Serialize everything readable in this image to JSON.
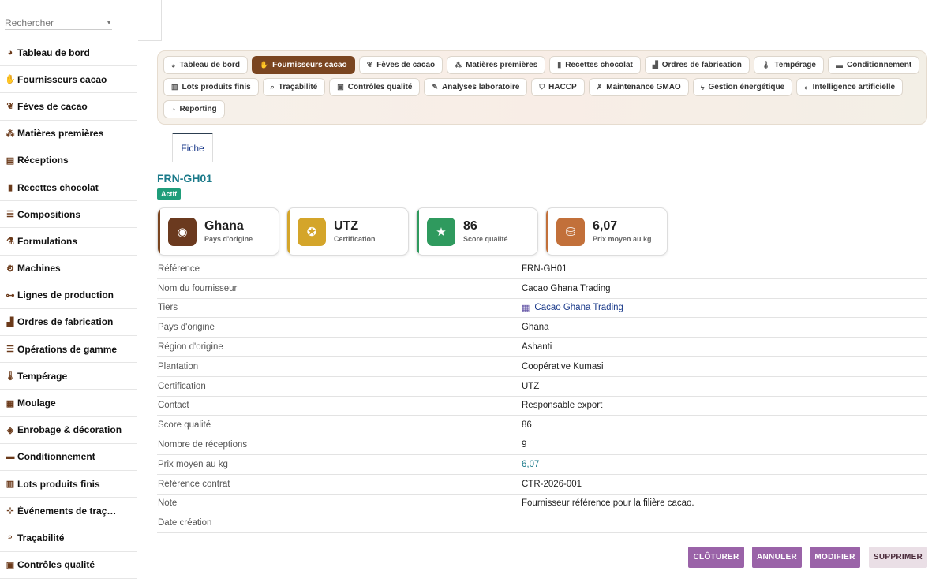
{
  "search": {
    "placeholder": "Rechercher"
  },
  "sidebar": {
    "items": [
      {
        "label": "Tableau de bord",
        "icon": "gauge-icon",
        "glyph": "◕"
      },
      {
        "label": "Fournisseurs cacao",
        "icon": "handshake-icon",
        "glyph": "✋"
      },
      {
        "label": "Fèves de cacao",
        "icon": "seedling-icon",
        "glyph": "❦"
      },
      {
        "label": "Matières premières",
        "icon": "cubes-icon",
        "glyph": "⁂"
      },
      {
        "label": "Réceptions",
        "icon": "truck-loading-icon",
        "glyph": "▤"
      },
      {
        "label": "Recettes chocolat",
        "icon": "book-icon",
        "glyph": "▮"
      },
      {
        "label": "Compositions",
        "icon": "list-icon",
        "glyph": "☰"
      },
      {
        "label": "Formulations",
        "icon": "flask-icon",
        "glyph": "⚗"
      },
      {
        "label": "Machines",
        "icon": "gears-icon",
        "glyph": "⚙"
      },
      {
        "label": "Lignes de production",
        "icon": "diagram-icon",
        "glyph": "⊶"
      },
      {
        "label": "Ordres de fabrication",
        "icon": "industry-icon",
        "glyph": "▟"
      },
      {
        "label": "Opérations de gamme",
        "icon": "list-check-icon",
        "glyph": "☰"
      },
      {
        "label": "Tempérage",
        "icon": "thermometer-icon",
        "glyph": "🌡"
      },
      {
        "label": "Moulage",
        "icon": "grid-icon",
        "glyph": "▦"
      },
      {
        "label": "Enrobage & décoration",
        "icon": "fill-drip-icon",
        "glyph": "◈"
      },
      {
        "label": "Conditionnement",
        "icon": "box-icon",
        "glyph": "▬"
      },
      {
        "label": "Lots produits finis",
        "icon": "barcode-icon",
        "glyph": "▥"
      },
      {
        "label": "Événements de traç…",
        "icon": "sitemap-icon",
        "glyph": "⊹"
      },
      {
        "label": "Traçabilité",
        "icon": "search-icon",
        "glyph": "⌕"
      },
      {
        "label": "Contrôles qualité",
        "icon": "clipboard-check-icon",
        "glyph": "▣"
      }
    ]
  },
  "nav": {
    "rows": [
      [
        {
          "label": "Tableau de bord",
          "icon": "gauge-icon",
          "glyph": "◕",
          "active": false
        },
        {
          "label": "Fournisseurs cacao",
          "icon": "handshake-icon",
          "glyph": "✋",
          "active": true
        },
        {
          "label": "Fèves de cacao",
          "icon": "seedling-icon",
          "glyph": "❦",
          "active": false
        },
        {
          "label": "Matières premières",
          "icon": "cubes-icon",
          "glyph": "⁂",
          "active": false
        },
        {
          "label": "Recettes chocolat",
          "icon": "book-icon",
          "glyph": "▮",
          "active": false
        },
        {
          "label": "Ordres de fabrication",
          "icon": "industry-icon",
          "glyph": "▟",
          "active": false
        },
        {
          "label": "Tempérage",
          "icon": "thermometer-icon",
          "glyph": "🌡",
          "active": false
        },
        {
          "label": "Conditionnement",
          "icon": "box-icon",
          "glyph": "▬",
          "active": false
        }
      ],
      [
        {
          "label": "Lots produits finis",
          "icon": "barcode-icon",
          "glyph": "▥",
          "active": false
        },
        {
          "label": "Traçabilité",
          "icon": "search-icon",
          "glyph": "⌕",
          "active": false
        },
        {
          "label": "Contrôles qualité",
          "icon": "clipboard-check-icon",
          "glyph": "▣",
          "active": false
        },
        {
          "label": "Analyses laboratoire",
          "icon": "pen-icon",
          "glyph": "✎",
          "active": false
        },
        {
          "label": "HACCP",
          "icon": "shield-icon",
          "glyph": "⛉",
          "active": false
        },
        {
          "label": "Maintenance GMAO",
          "icon": "tools-icon",
          "glyph": "✗",
          "active": false
        },
        {
          "label": "Gestion énergétique",
          "icon": "bolt-icon",
          "glyph": "ϟ",
          "active": false
        },
        {
          "label": "Intelligence artificielle",
          "icon": "brain-icon",
          "glyph": "◐",
          "active": false
        }
      ],
      [
        {
          "label": "Reporting",
          "icon": "pie-chart-icon",
          "glyph": "◔",
          "active": false
        }
      ]
    ]
  },
  "tabs": {
    "fiche": "Fiche"
  },
  "record": {
    "title": "FRN-GH01",
    "status": "Actif"
  },
  "cards": [
    {
      "value": "Ghana",
      "label": "Pays d'origine",
      "icon": "globe-icon",
      "glyph": "◉",
      "color": "#6b3a1f",
      "bar": "#7a4520"
    },
    {
      "value": "UTZ",
      "label": "Certification",
      "icon": "award-icon",
      "glyph": "✪",
      "color": "#d4a52a",
      "bar": "#d4a52a"
    },
    {
      "value": "86",
      "label": "Score qualité",
      "icon": "star-icon",
      "glyph": "★",
      "color": "#2f9a5e",
      "bar": "#2f9a5e"
    },
    {
      "value": "6,07",
      "label": "Prix moyen au kg",
      "icon": "coins-icon",
      "glyph": "⛁",
      "color": "#c2703a",
      "bar": "#c2703a"
    }
  ],
  "details": [
    {
      "key": "Référence",
      "value": "FRN-GH01",
      "style": ""
    },
    {
      "key": "Nom du fournisseur",
      "value": "Cacao Ghana Trading",
      "style": ""
    },
    {
      "key": "Tiers",
      "value": "Cacao Ghana Trading",
      "style": "link",
      "icon": "building-icon"
    },
    {
      "key": "Pays d'origine",
      "value": "Ghana",
      "style": ""
    },
    {
      "key": "Région d'origine",
      "value": "Ashanti",
      "style": ""
    },
    {
      "key": "Plantation",
      "value": "Coopérative Kumasi",
      "style": ""
    },
    {
      "key": "Certification",
      "value": "UTZ",
      "style": ""
    },
    {
      "key": "Contact",
      "value": "Responsable export",
      "style": ""
    },
    {
      "key": "Score qualité",
      "value": "86",
      "style": ""
    },
    {
      "key": "Nombre de réceptions",
      "value": "9",
      "style": ""
    },
    {
      "key": "Prix moyen au kg",
      "value": "6,07",
      "style": "teal"
    },
    {
      "key": "Référence contrat",
      "value": "CTR-2026-001",
      "style": ""
    },
    {
      "key": "Note",
      "value": "Fournisseur référence pour la filière cacao.",
      "style": ""
    },
    {
      "key": "Date création",
      "value": "",
      "style": ""
    }
  ],
  "actions": {
    "cloturer": "CLÔTURER",
    "annuler": "ANNULER",
    "modifier": "MODIFIER",
    "supprimer": "SUPPRIMER"
  },
  "colors": {
    "accent": "#7a4520",
    "teal": "#1b7a8a",
    "status": "#1f9d7a",
    "action_purple": "#9a63a8",
    "action_light": "#eadfe6"
  }
}
